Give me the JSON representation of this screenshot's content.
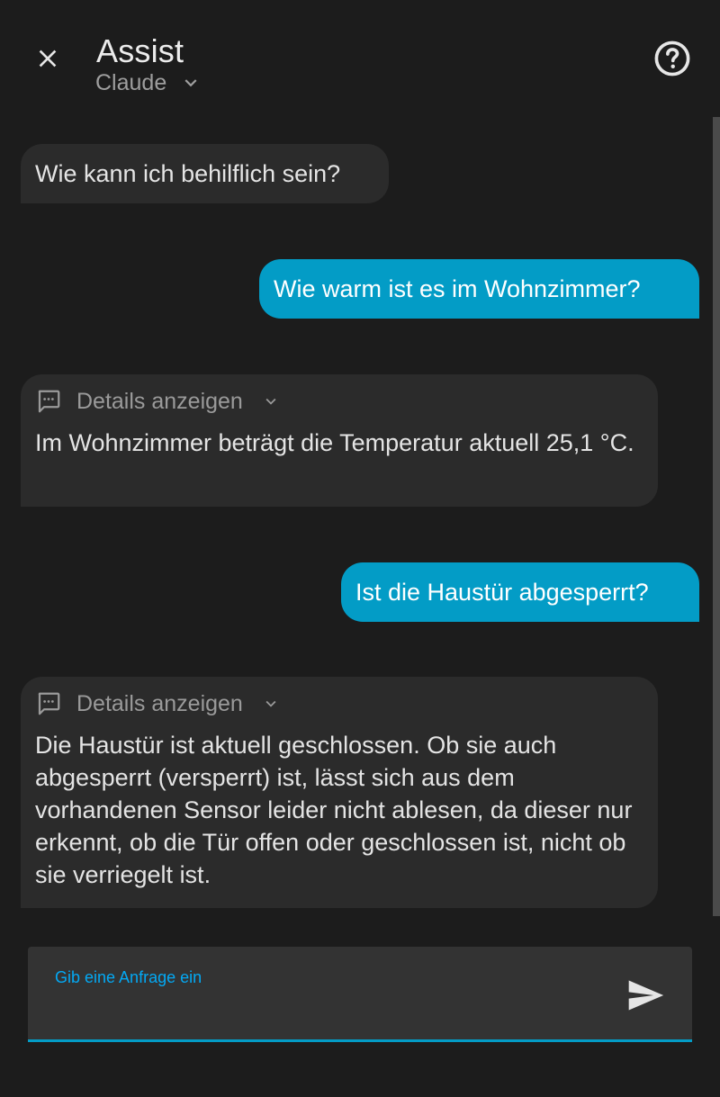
{
  "header": {
    "title": "Assist",
    "agent": "Claude",
    "close_icon": "close-icon",
    "help_icon": "help-circle-icon"
  },
  "messages": [
    {
      "from": "hass",
      "text": "Wie kann ich behilflich sein?"
    },
    {
      "from": "user",
      "text": "Wie warm ist es im Wohnzimmer?"
    },
    {
      "from": "hass",
      "details_label": "Details anzeigen",
      "text": "Im Wohnzimmer beträgt die Temperatur aktuell 25,1 °C."
    },
    {
      "from": "user",
      "text": "Ist die Haustür abgesperrt?"
    },
    {
      "from": "hass",
      "details_label": "Details anzeigen",
      "text": "Die Haustür ist aktuell geschlossen. Ob sie auch abgesperrt (versperrt) ist, lässt sich aus dem vorhandenen Sensor leider nicht ablesen, da dieser nur erkennt, ob die Tür offen oder geschlossen ist, nicht ob sie verriegelt ist."
    }
  ],
  "input": {
    "label": "Gib eine Anfrage ein",
    "value": "",
    "send_icon": "send-icon"
  },
  "colors": {
    "background": "#1c1c1c",
    "assistant_bubble": "#2b2b2b",
    "user_bubble": "#039cc6",
    "accent": "#03a9f4"
  }
}
